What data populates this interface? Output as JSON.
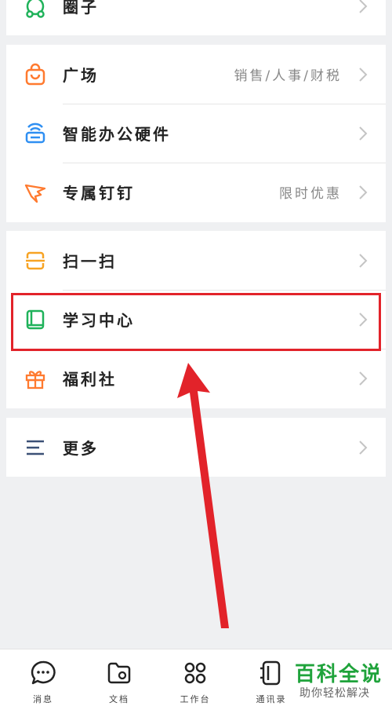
{
  "menu": {
    "group0": {
      "items": [
        {
          "label": "圈子",
          "extra": ""
        }
      ]
    },
    "group1": {
      "items": [
        {
          "label": "广场",
          "extra": "销售/人事/财税"
        },
        {
          "label": "智能办公硬件",
          "extra": ""
        },
        {
          "label": "专属钉钉",
          "extra": "限时优惠"
        }
      ]
    },
    "group2": {
      "items": [
        {
          "label": "扫一扫",
          "extra": ""
        },
        {
          "label": "学习中心",
          "extra": ""
        },
        {
          "label": "福利社",
          "extra": ""
        }
      ]
    },
    "group3": {
      "items": [
        {
          "label": "更多",
          "extra": ""
        }
      ]
    }
  },
  "icons": {
    "circle": "people-circle-icon",
    "square": "shopping-bag-icon",
    "hardware": "router-icon",
    "exclusive": "wing-icon",
    "scan": "scan-icon",
    "learning": "book-icon",
    "welfare": "gift-icon",
    "more": "menu-lines-icon"
  },
  "colors": {
    "green": "#1fb25a",
    "orange": "#ff7a2f",
    "blue": "#2f8ff2",
    "amber": "#f7a323",
    "navy": "#3c5176",
    "highlight": "#e2232a"
  },
  "tabbar": {
    "tabs": [
      {
        "label": "消息",
        "icon": "chat-icon"
      },
      {
        "label": "文档",
        "icon": "folder-icon"
      },
      {
        "label": "工作台",
        "icon": "grid-icon"
      },
      {
        "label": "通讯录",
        "icon": "contacts-icon"
      }
    ]
  },
  "watermark": {
    "title": "百科全说",
    "subtitle": "助你轻松解决"
  }
}
